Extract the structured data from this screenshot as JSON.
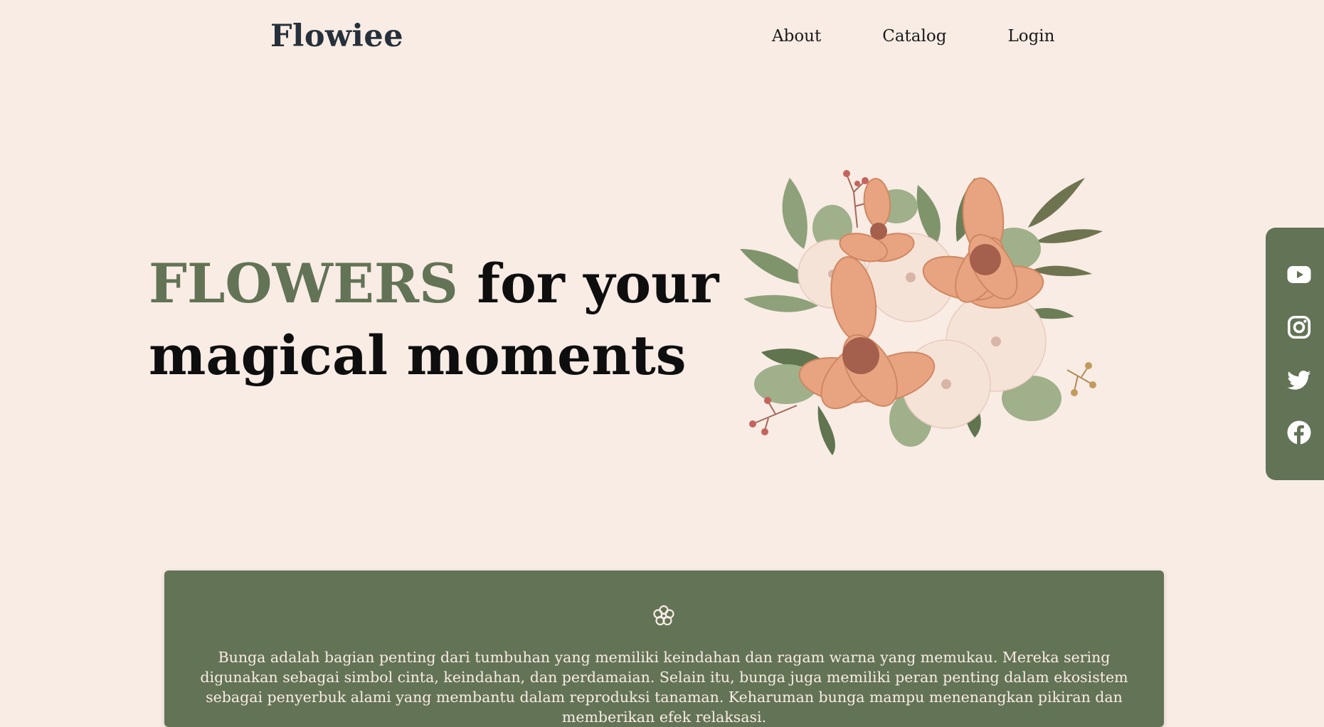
{
  "header": {
    "brand": "Flowiee",
    "nav": [
      {
        "label": "About"
      },
      {
        "label": "Catalog"
      },
      {
        "label": "Login"
      }
    ]
  },
  "hero": {
    "title_accent": "FLOWERS",
    "title_rest_line1": " for your",
    "title_line2": "magical moments"
  },
  "social": {
    "icons": [
      "youtube-icon",
      "instagram-icon",
      "twitter-icon",
      "facebook-icon"
    ]
  },
  "info": {
    "icon": "flower-icon",
    "text": "Bunga adalah bagian penting dari tumbuhan yang memiliki keindahan dan ragam warna yang memukau. Mereka sering digunakan sebagai simbol cinta, keindahan, dan perdamaian. Selain itu, bunga juga memiliki peran penting dalam ekosistem sebagai penyerbuk alami yang membantu dalam reproduksi tanaman. Keharuman bunga mampu menenangkan pikiran dan memberikan efek relaksasi."
  },
  "colors": {
    "background": "#f8ece4",
    "accent_green": "#637356",
    "peach": "#e8a481",
    "dark_text": "#26303a"
  }
}
